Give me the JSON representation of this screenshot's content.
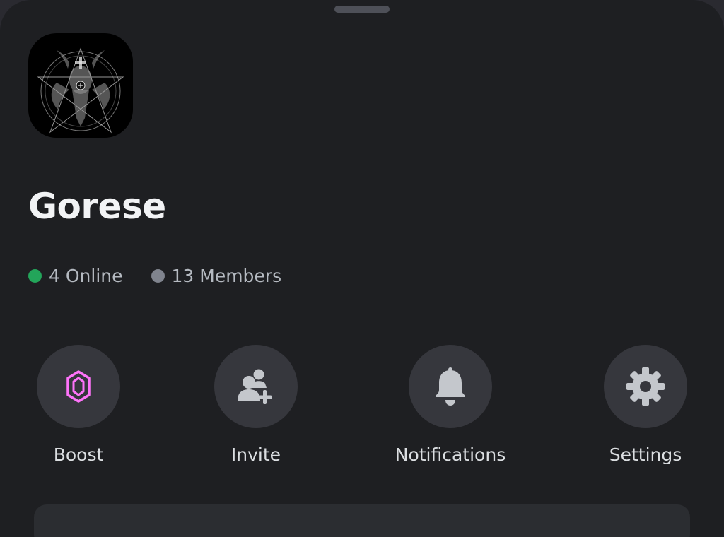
{
  "server": {
    "name": "Gorese",
    "online_label": "4 Online",
    "members_label": "13 Members"
  },
  "actions": {
    "boost": {
      "label": "Boost",
      "icon": "boost-gem-icon"
    },
    "invite": {
      "label": "Invite",
      "icon": "add-person-icon"
    },
    "notifications": {
      "label": "Notifications",
      "icon": "bell-icon"
    },
    "settings": {
      "label": "Settings",
      "icon": "gear-icon"
    }
  },
  "colors": {
    "sheet_background": "#1e1f22",
    "button_background": "#36373d",
    "online": "#23a55a",
    "members": "#80848e",
    "boost_accent": "#ff73fa",
    "title_text": "#f2f3f5",
    "muted_text": "#b5bac1"
  }
}
